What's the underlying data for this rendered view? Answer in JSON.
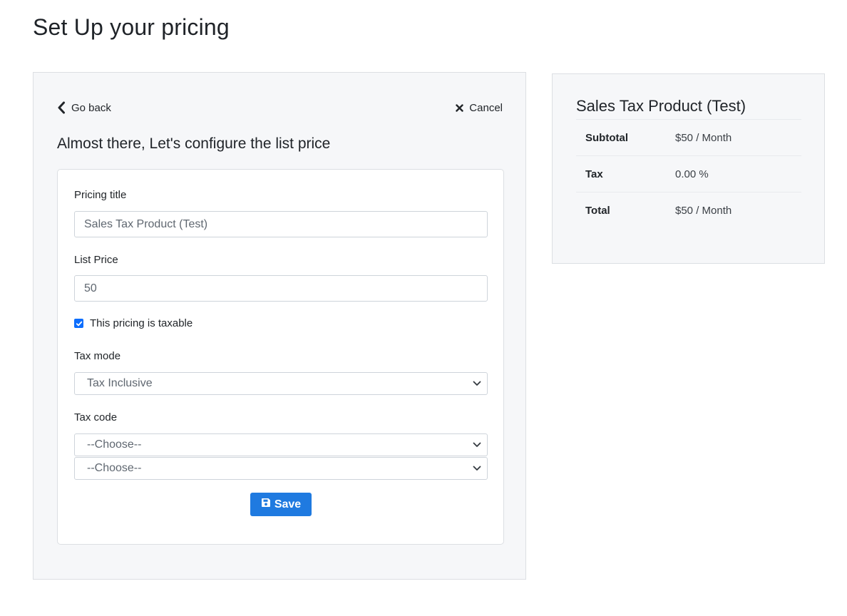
{
  "page": {
    "title": "Set Up your pricing"
  },
  "nav": {
    "back_label": "Go back",
    "cancel_label": "Cancel"
  },
  "form": {
    "heading": "Almost there, Let's configure the list price",
    "pricing_title": {
      "label": "Pricing title",
      "value": "Sales Tax Product (Test)"
    },
    "list_price": {
      "label": "List Price",
      "value": "50"
    },
    "taxable": {
      "label": "This pricing is taxable",
      "checked": true
    },
    "tax_mode": {
      "label": "Tax mode",
      "selected": "Tax Inclusive"
    },
    "tax_code": {
      "label": "Tax code",
      "selects": [
        "--Choose--",
        "--Choose--"
      ]
    },
    "save_label": "Save"
  },
  "summary": {
    "title": "Sales Tax Product (Test)",
    "rows": [
      {
        "label": "Subtotal",
        "value": "$50 / Month"
      },
      {
        "label": "Tax",
        "value": "0.00 %"
      },
      {
        "label": "Total",
        "value": "$50 / Month"
      }
    ]
  },
  "colors": {
    "accent": "#1f7ae0",
    "checkbox": "#0d6efd",
    "panel_bg": "#f6f7f9"
  },
  "icons": {
    "back": "chevron-left-icon",
    "cancel": "close-icon",
    "save": "floppy-disk-icon",
    "select": "chevron-down-icon",
    "checkbox": "checkmark-icon"
  }
}
